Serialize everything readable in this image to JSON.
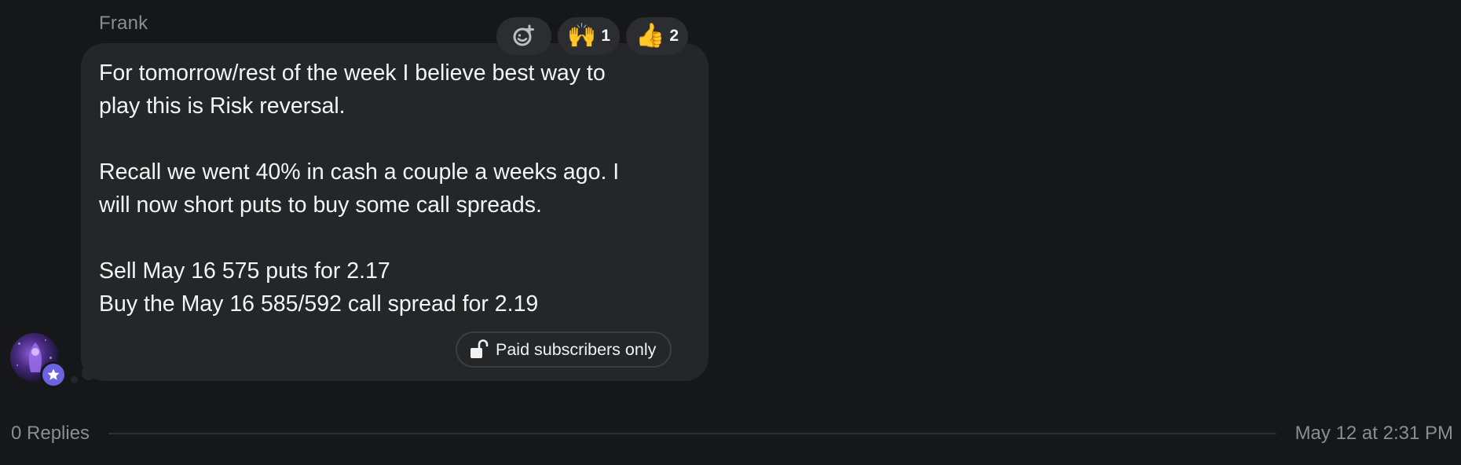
{
  "message": {
    "sender": "Frank",
    "paragraphs": [
      "For tomorrow/rest of the week I believe best way to\nplay this is Risk reversal.",
      "Recall we went 40% in cash a couple a weeks ago. I\nwill now short puts to buy some call spreads.",
      "Sell May 16 575 puts for 2.17\nBuy the May 16 585/592 call spread for 2.19"
    ],
    "paid_badge_label": "Paid subscribers only",
    "paid_badge_icon": "unlock-icon"
  },
  "reactions": {
    "add_reaction_icon": "add-emoji-icon",
    "items": [
      {
        "emoji": "🙌",
        "count": "1",
        "icon": "raised-hands-emoji"
      },
      {
        "emoji": "👍",
        "count": "2",
        "icon": "thumbs-up-emoji"
      }
    ]
  },
  "avatar": {
    "badge_icon": "star-icon",
    "badge_color": "#6b63e0"
  },
  "footer": {
    "replies": "0 Replies",
    "timestamp": "May 12 at 2:31 PM"
  },
  "colors": {
    "background": "#16171a",
    "bubble": "#242628",
    "muted_text": "#8c8d90"
  }
}
